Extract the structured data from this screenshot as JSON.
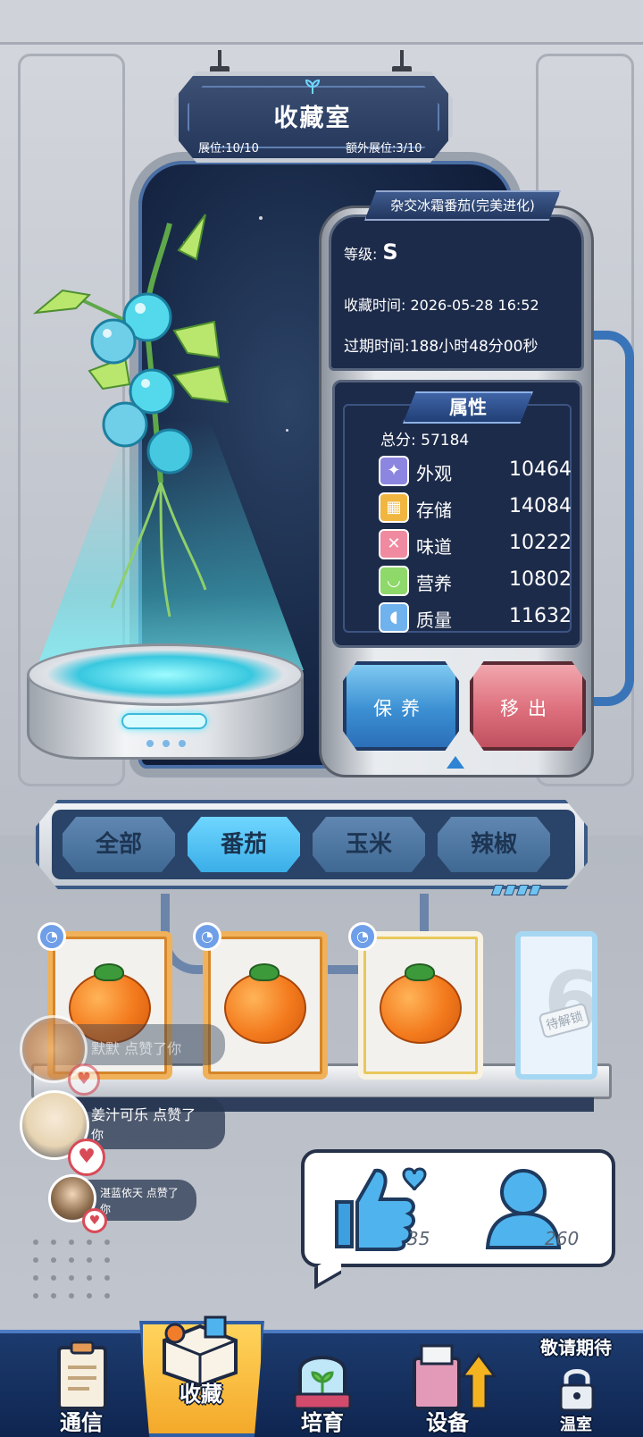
{
  "header": {
    "title": "收藏室",
    "slots_label": "展位:10/10",
    "extra_slots_label": "额外展位:3/10"
  },
  "plant": {
    "name": "杂交冰霜番茄(完美进化)",
    "grade_label": "等级:",
    "grade": "S",
    "collected_time": "收藏时间: 2026-05-28 16:52",
    "expire_time": "过期时间:188小时48分00秒"
  },
  "attributes": {
    "header": "属性",
    "total": "总分: 57184",
    "items": [
      {
        "name": "外观",
        "value": "10464",
        "icon": "sparkle-icon",
        "color": "#8c86e0"
      },
      {
        "name": "存储",
        "value": "14084",
        "icon": "box-icon",
        "color": "#f0b640"
      },
      {
        "name": "味道",
        "value": "10222",
        "icon": "fork-spoon-icon",
        "color": "#f08aa0"
      },
      {
        "name": "营养",
        "value": "10802",
        "icon": "bowl-icon",
        "color": "#8fd86a"
      },
      {
        "name": "质量",
        "value": "11632",
        "icon": "muscle-icon",
        "color": "#6fb2ee"
      }
    ]
  },
  "actions": {
    "maintain": "保养",
    "remove": "移出"
  },
  "tabs": [
    {
      "label": "全部",
      "active": false
    },
    {
      "label": "番茄",
      "active": true
    },
    {
      "label": "玉米",
      "active": false
    },
    {
      "label": "辣椒",
      "active": false
    }
  ],
  "shelf": {
    "locked_number": "6",
    "locked_label": "待解锁"
  },
  "likes": [
    {
      "text": "默默 点赞了你"
    },
    {
      "text": "姜汁可乐 点赞了",
      "text2": "你"
    },
    {
      "text": "湛蓝依天 点赞了",
      "text2": "你"
    }
  ],
  "stats": {
    "likes_count": "35",
    "visitors_count": "260"
  },
  "nav": {
    "items": [
      "通信",
      "收藏",
      "培育",
      "设备"
    ],
    "coming_soon": "敬请期待",
    "greenhouse": "温室"
  },
  "colors": {
    "accent_blue": "#3aaee8",
    "remove_red": "#dd6f7c",
    "nav_active": "#f4a92a"
  }
}
